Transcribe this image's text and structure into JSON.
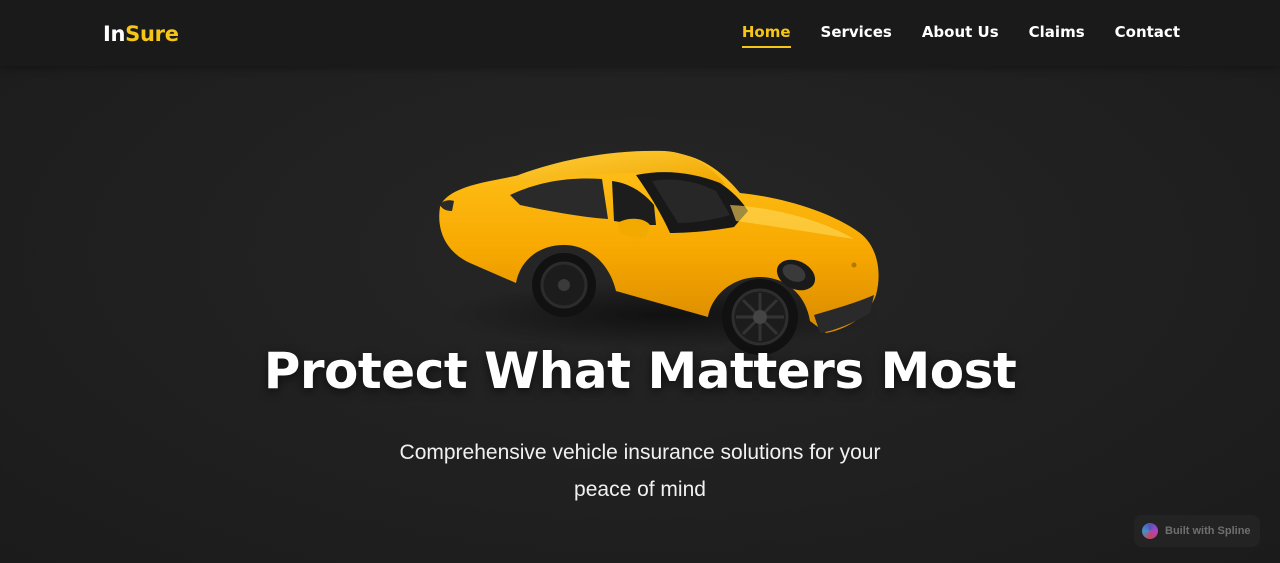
{
  "brand": {
    "part_a": "In",
    "part_b": "Sure",
    "accent_color": "#f5c518"
  },
  "nav": {
    "links": [
      {
        "label": "Home",
        "active": true
      },
      {
        "label": "Services",
        "active": false
      },
      {
        "label": "About Us",
        "active": false
      },
      {
        "label": "Claims",
        "active": false
      },
      {
        "label": "Contact",
        "active": false
      }
    ]
  },
  "hero": {
    "title": "Protect What Matters Most",
    "subtitle": "Comprehensive vehicle insurance solutions for your peace of mind",
    "image": "yellow-sports-car-3d-model"
  },
  "badge": {
    "label": "Built with Spline",
    "icon": "spline-logo-icon"
  }
}
